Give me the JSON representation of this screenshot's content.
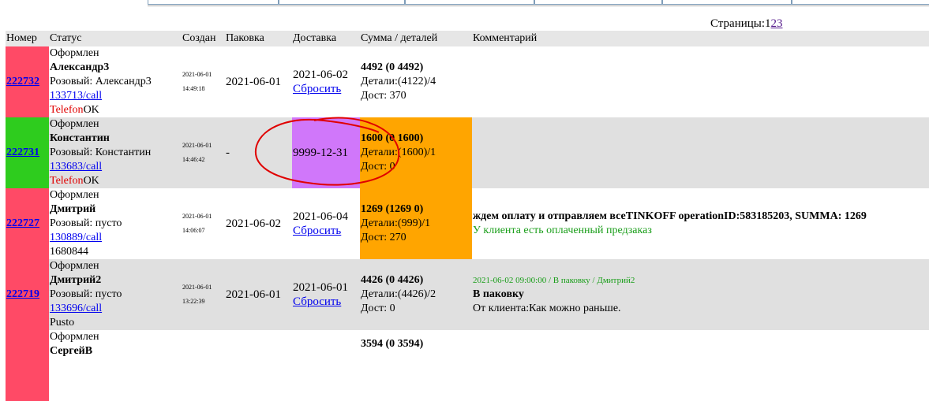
{
  "pagination": {
    "label": "Страницы:",
    "pages": [
      "1",
      "2",
      "3"
    ]
  },
  "columns": [
    "Номер",
    "Статус",
    "Создан",
    "Паковка",
    "Доставка",
    "Сумма / деталей",
    "Комментарий"
  ],
  "colors": {
    "red": "#ff4a66",
    "green": "#2ecc1e",
    "purple": "#d077fa",
    "orange": "#ffa500"
  },
  "rows": [
    {
      "id": "222732",
      "status": "Оформлен",
      "name": "Александр3",
      "delivery_type": "Розовый: Александр3",
      "call": "133713/call",
      "tel_label": "Telefon",
      "tel_status": "OK",
      "created_date": "2021-06-01",
      "created_time": "14:49:18",
      "packing": "2021-06-01",
      "delivery": "2021-06-02",
      "reset": "Сбросить",
      "sum": "4492 (0 4492)",
      "details": "Детали:(4122)/4",
      "dost": "Дост: 370",
      "comment": ""
    },
    {
      "id": "222731",
      "status": "Оформлен",
      "name": "Константин",
      "delivery_type": "Розовый: Константин",
      "call": "133683/call",
      "tel_label": "Telefon",
      "tel_status": "OK",
      "created_date": "2021-06-01",
      "created_time": "14:46:42",
      "packing": "-",
      "delivery": "9999-12-31",
      "sum": "1600 (0 1600)",
      "details": "Детали:(1600)/1",
      "dost": "Дост: 0",
      "comment": ""
    },
    {
      "id": "222727",
      "status": "Оформлен",
      "name": "Дмитрий",
      "delivery_type": "Розовый: пусто",
      "call": "130889/call",
      "extra": "1680844",
      "created_date": "2021-06-01",
      "created_time": "14:06:07",
      "packing": "2021-06-02",
      "delivery": "2021-06-04",
      "reset": "Сбросить",
      "sum": "1269 (1269 0)",
      "details": "Детали:(999)/1",
      "dost": "Дост: 270",
      "comment_bold": "ждем оплату и отправляем всеTINKOFF operationID:583185203, SUMMA: 1269",
      "comment_green": "У клиента есть оплаченный предзаказ"
    },
    {
      "id": "222719",
      "status": "Оформлен",
      "name": "Дмитрий2",
      "delivery_type": "Розовый: пусто",
      "call": "133696/call",
      "extra": "Pusto",
      "created_date": "2021-06-01",
      "created_time": "13:22:39",
      "packing": "2021-06-01",
      "delivery": "2021-06-01",
      "reset": "Сбросить",
      "sum": "4426 (0 4426)",
      "details": "Детали:(4426)/2",
      "dost": "Дост: 0",
      "history": "2021-06-02 09:00:00 / В паковку / Дмитрий2",
      "comment_bold": "В паковку",
      "comment_plain": "От клиента:Как можно раньше."
    },
    {
      "status": "Оформлен",
      "name": "СергейВ",
      "sum": "3594 (0 3594)"
    }
  ]
}
